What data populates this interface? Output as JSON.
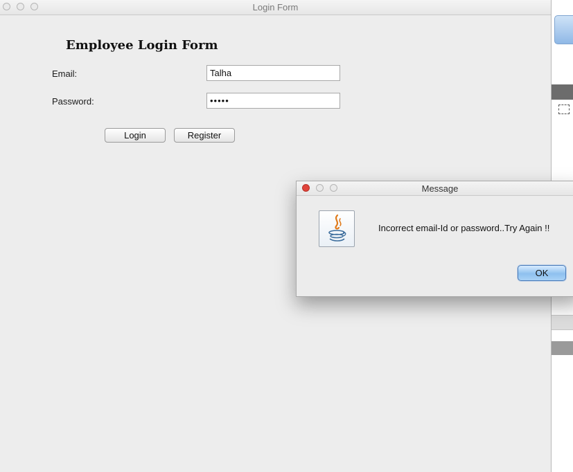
{
  "window": {
    "title": "Login Form"
  },
  "form": {
    "heading": "Employee Login Form",
    "email_label": "Email:",
    "email_value": "Talha",
    "password_label": "Password:",
    "password_value": "•••••",
    "login_label": "Login",
    "register_label": "Register"
  },
  "dialog": {
    "title": "Message",
    "icon": "java-icon",
    "message": "Incorrect email-Id or password..Try Again !!",
    "ok_label": "OK"
  },
  "colors": {
    "window_bg": "#ededed",
    "ok_button": "#8ec0ef",
    "close_button": "#e0443b"
  }
}
